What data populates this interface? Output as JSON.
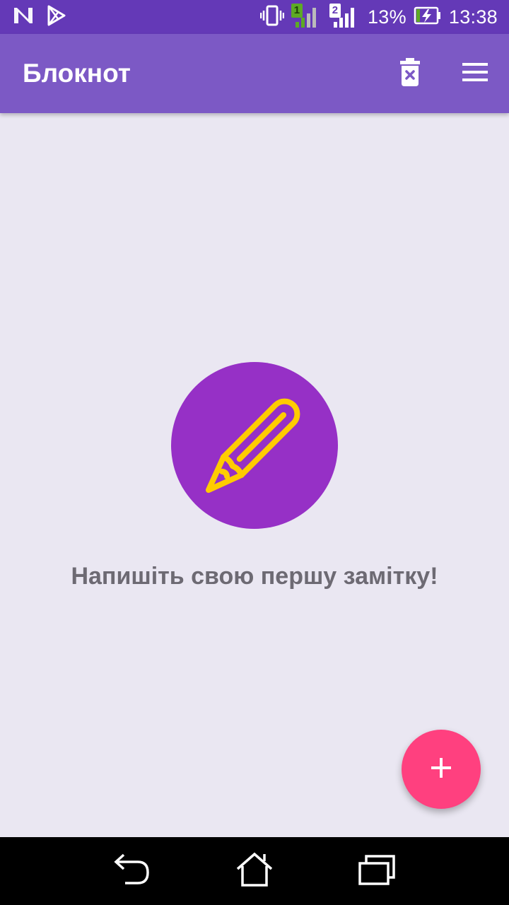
{
  "status_bar": {
    "battery_percent": "13%",
    "time": "13:38",
    "sim1_label": "1",
    "sim2_label": "2",
    "icons": [
      "n-icon",
      "play-store-icon",
      "vibrate-icon",
      "signal-sim1-icon",
      "signal-sim2-icon",
      "battery-charging-icon"
    ]
  },
  "app_bar": {
    "title": "Блокнот",
    "actions": [
      "delete-icon",
      "menu-icon"
    ]
  },
  "empty_state": {
    "icon": "pencil-icon",
    "message": "Напишіть свою першу замітку!"
  },
  "fab": {
    "icon": "plus-icon"
  },
  "nav_bar": {
    "buttons": [
      "back-icon",
      "home-icon",
      "recents-icon"
    ]
  },
  "colors": {
    "status_bar": "#6439B7",
    "app_bar": "#7C59C5",
    "background": "#EAE7F2",
    "icon_circle": "#9630C6",
    "pencil": "#FFCC00",
    "fab": "#FF407F",
    "message_text": "#6D6A73",
    "sim1_badge": "#5DAA24"
  }
}
